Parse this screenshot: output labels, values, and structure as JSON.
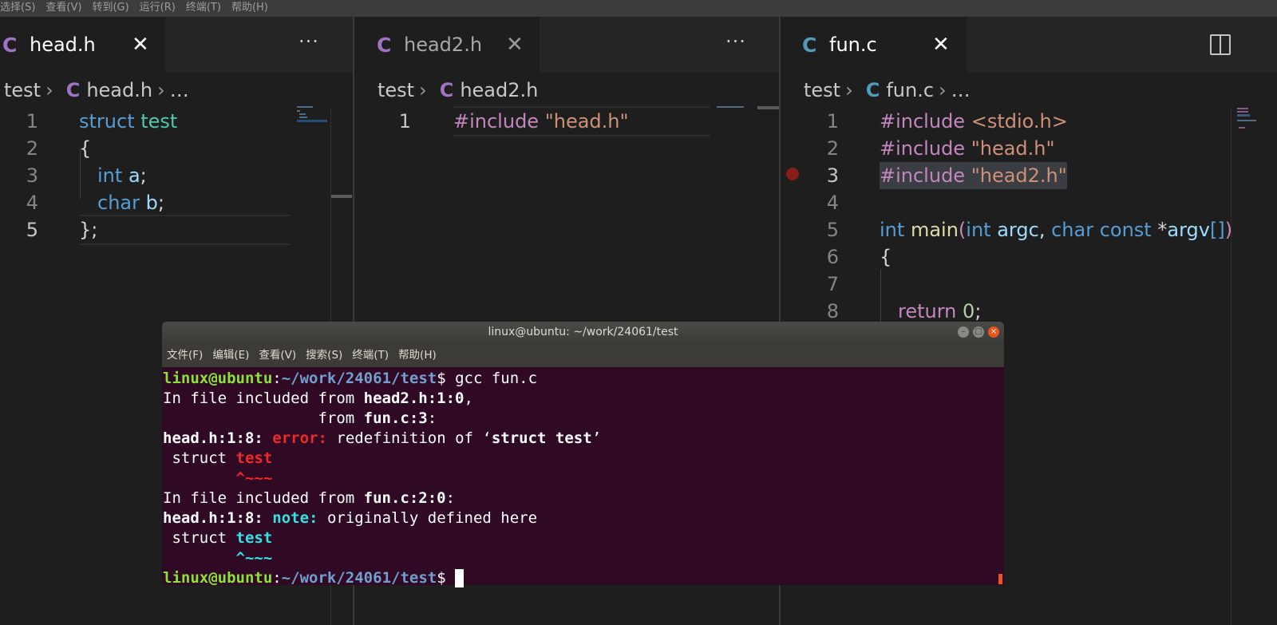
{
  "menubar": {
    "items": [
      "选择(S)",
      "查看(V)",
      "转到(G)",
      "运行(R)",
      "终端(T)",
      "帮助(H)"
    ]
  },
  "panes": [
    {
      "tab": {
        "icon": "C",
        "name": "head.h"
      },
      "breadcrumb": {
        "folder": "test",
        "icon": "C",
        "file": "head.h",
        "more": "…"
      },
      "line_numbers": [
        "1",
        "2",
        "3",
        "4",
        "5"
      ],
      "lines": [
        "struct test",
        "{",
        "int a;",
        "char b;",
        "};"
      ]
    },
    {
      "tab": {
        "icon": "C",
        "name": "head2.h"
      },
      "breadcrumb": {
        "folder": "test",
        "icon": "C",
        "file": "head2.h"
      },
      "line_numbers": [
        "1"
      ],
      "lines": [
        "#include \"head.h\""
      ]
    },
    {
      "tab": {
        "icon": "C",
        "name": "fun.c"
      },
      "breadcrumb": {
        "folder": "test",
        "icon": "C",
        "file": "fun.c",
        "more": "…"
      },
      "line_numbers": [
        "1",
        "2",
        "3",
        "4",
        "5",
        "6",
        "7",
        "8"
      ],
      "lines": [
        "#include <stdio.h>",
        "#include \"head.h\"",
        "#include \"head2.h\"",
        "",
        "int main(int argc, char const *argv[])",
        "{",
        "",
        "return 0;"
      ]
    }
  ],
  "ui": {
    "more_actions": "···",
    "close_glyph": "✕"
  },
  "terminal": {
    "title": "linux@ubuntu: ~/work/24061/test",
    "menu": [
      "文件(F)",
      "编辑(E)",
      "查看(V)",
      "搜索(S)",
      "终端(T)",
      "帮助(H)"
    ],
    "prompt_user": "linux@ubuntu",
    "prompt_path": "~/work/24061/test",
    "command": "gcc fun.c",
    "output": [
      "In file included from head2.h:1:0,",
      "from fun.c:3:",
      "head.h:1:8: error: redefinition of ‘struct test’",
      "struct test",
      "^~~~",
      "In file included from fun.c:2:0:",
      "head.h:1:8: note: originally defined here",
      "struct test",
      "^~~~"
    ]
  },
  "colors": {
    "editor_bg": "#1e1e1e",
    "terminal_bg": "#300a24",
    "c_icon_header": "#a074c4",
    "c_icon_source": "#519aba",
    "error": "#ef2929",
    "note": "#34e2e2",
    "prompt_user": "#8ae234",
    "prompt_path": "#729fcf"
  },
  "icons": [
    "close-icon",
    "more-actions-icon",
    "split-editor-icon",
    "chevron-right-icon",
    "breakpoint-icon",
    "window-minimize-icon",
    "window-maximize-icon",
    "window-close-icon"
  ]
}
